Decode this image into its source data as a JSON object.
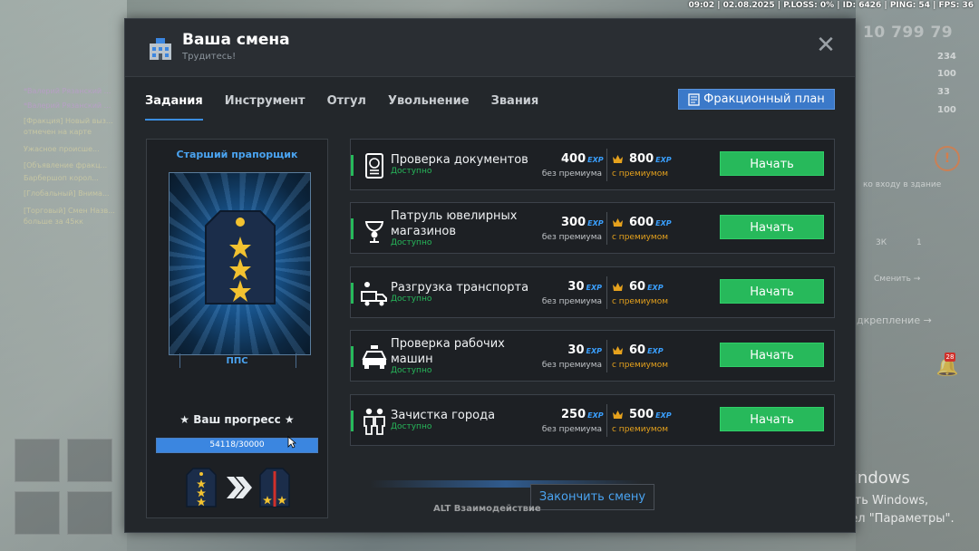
{
  "statusbar": "09:02 | 02.08.2025 | P.LOSS: 0% | ID: 6426 | PING: 54 | FPS: 36",
  "hud": {
    "money": "10 799 79",
    "stats": [
      "234",
      "100",
      "33",
      "100"
    ],
    "entrance_text": "ко входу в здание",
    "items": [
      "3К",
      "1"
    ],
    "switch_text": "Сменить →",
    "reinforcement_text": "дкрепление →",
    "notification_count": "28"
  },
  "chat": [
    "*Валерий Рязанский ...",
    "*Валерий Рязанский ...",
    "[Фракция] Новый выз...",
    "отмечен на карте",
    "Ужасное происше...",
    "[Объявление фракц...",
    "Барбершоп корол...",
    "[Глобальный] Внима...",
    "[Торговый] Смен Назв...",
    "больше за 45кк"
  ],
  "dialog": {
    "title": "Ваша смена",
    "subtitle": "Трудитесь!",
    "tabs": [
      "Задания",
      "Инструмент",
      "Отгул",
      "Увольнение",
      "Звания"
    ],
    "active_tab": "Задания",
    "plan_button": "Фракционный план"
  },
  "rank": {
    "title": "Старший прапорщик",
    "unit": "ППС",
    "progress_label": "★ Ваш прогресс ★",
    "progress_current": 54118,
    "progress_max": 30000,
    "progress_text": "54118/30000"
  },
  "exp_tag": "EXP",
  "basic_label": "без премиума",
  "premium_label": "с премиумом",
  "start_label": "Начать",
  "tasks": [
    {
      "icon": "passport-icon",
      "name": "Проверка документов",
      "status": "Доступно",
      "exp": "400",
      "exp_premium": "800"
    },
    {
      "icon": "jewelry-icon",
      "name": "Патруль ювелирных магазинов",
      "status": "Доступно",
      "exp": "300",
      "exp_premium": "600"
    },
    {
      "icon": "truck-icon",
      "name": "Разгрузка транспорта",
      "status": "Доступно",
      "exp": "30",
      "exp_premium": "60"
    },
    {
      "icon": "car-icon",
      "name": "Проверка рабочих машин",
      "status": "Доступно",
      "exp": "30",
      "exp_premium": "60"
    },
    {
      "icon": "people-icon",
      "name": "Зачистка города",
      "status": "Доступно",
      "exp": "250",
      "exp_premium": "500"
    }
  ],
  "finish_button": "Закончить смену",
  "alt_hint": "ALT Взаимодействие",
  "windows": {
    "title": "Активация Windows",
    "subtitle": "Чтобы активировать Windows, перейдите в раздел \"Параметры\"."
  },
  "colors": {
    "accent_green": "#27b95b",
    "accent_blue": "#3b86e0",
    "premium_gold": "#e6a21d",
    "panel_bg": "#23272b"
  }
}
